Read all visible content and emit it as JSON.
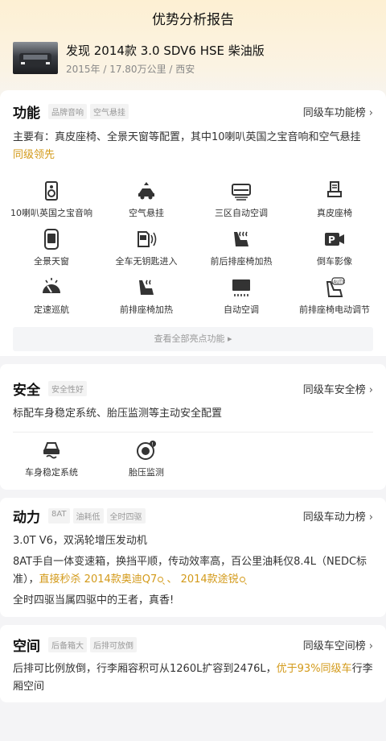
{
  "page": {
    "title": "优势分析报告"
  },
  "car": {
    "name": "发现 2014款 3.0 SDV6 HSE 柴油版",
    "meta": "2015年 / 17.80万公里 / 西安"
  },
  "function": {
    "title": "功能",
    "tags": [
      "品牌音响",
      "空气悬挂"
    ],
    "rank_link": "同级车功能榜",
    "summary": "主要有：真皮座椅、全景天窗等配置，其中10喇叭英国之宝音响和空气悬挂",
    "summary_highlight": "同级领先",
    "features": [
      {
        "label": "10喇叭英国之宝音响",
        "icon": "speaker-icon"
      },
      {
        "label": "空气悬挂",
        "icon": "air-suspension-icon"
      },
      {
        "label": "三区自动空调",
        "icon": "ac-icon"
      },
      {
        "label": "真皮座椅",
        "icon": "leather-seat-icon"
      },
      {
        "label": "全景天窗",
        "icon": "sunroof-icon"
      },
      {
        "label": "全车无钥匙进入",
        "icon": "keyless-entry-icon"
      },
      {
        "label": "前后排座椅加热",
        "icon": "seat-heating-icon"
      },
      {
        "label": "倒车影像",
        "icon": "parking-camera-icon"
      },
      {
        "label": "定速巡航",
        "icon": "cruise-control-icon"
      },
      {
        "label": "前排座椅加热",
        "icon": "front-seat-heating-icon"
      },
      {
        "label": "自动空调",
        "icon": "auto-ac-icon"
      },
      {
        "label": "前排座椅电动调节",
        "icon": "power-seat-icon"
      }
    ],
    "more_label": "查看全部亮点功能"
  },
  "safety": {
    "title": "安全",
    "tags": [
      "安全性好"
    ],
    "rank_link": "同级车安全榜",
    "summary": "标配车身稳定系统、胎压监测等主动安全配置",
    "features": [
      {
        "label": "车身稳定系统",
        "icon": "stability-control-icon"
      },
      {
        "label": "胎压监测",
        "icon": "tire-pressure-icon"
      }
    ]
  },
  "power": {
    "title": "动力",
    "tags": [
      "8AT",
      "油耗低",
      "全时四驱"
    ],
    "rank_link": "同级车动力榜",
    "engine": "3.0T V6，双涡轮增压发动机",
    "gearbox": "8AT手自一体变速箱，换挡平顺，传动效率高，百公里油耗仅8.4L（NEDC标准），",
    "compare_prefix": "直接秒杀",
    "compare_1": "2014款奥迪Q7",
    "compare_sep": "、",
    "compare_2": "2014款途锐",
    "awd": "全时四驱当属四驱中的王者，真香!"
  },
  "space": {
    "title": "空间",
    "tags": [
      "后备箱大",
      "后排可放倒"
    ],
    "rank_link": "同级车空间榜",
    "summary": "后排可比例放倒，行李厢容积可从1260L扩容到2476L，",
    "highlight": "优于93%同级车",
    "summary_tail": "行李厢空间"
  },
  "colors": {
    "accent": "#d39a1a",
    "icon": "#333333",
    "tag_bg": "#f3f3f3"
  }
}
